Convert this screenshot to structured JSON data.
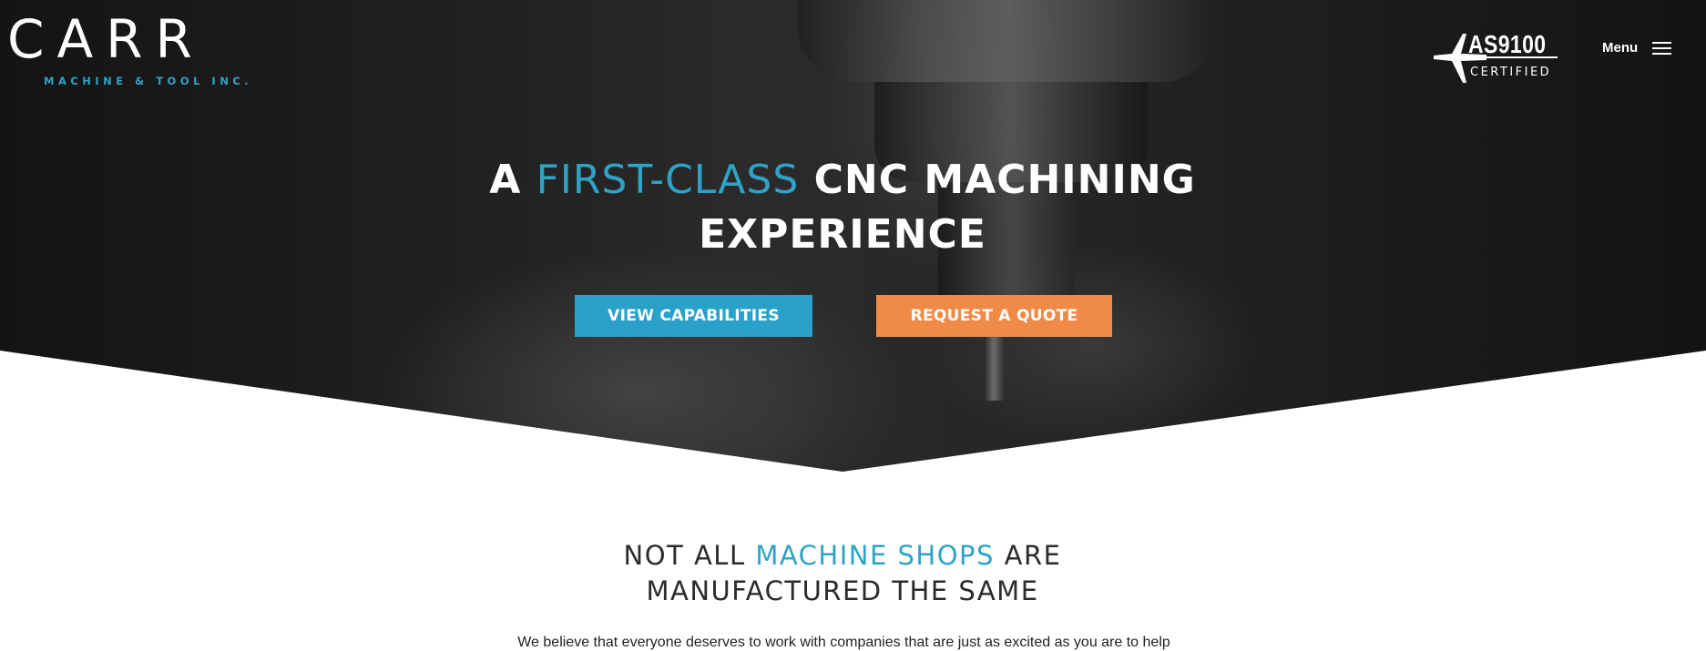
{
  "header": {
    "logo_word": "CARR",
    "logo_sub": "MACHINE & TOOL INC.",
    "cert_title": "AS9100",
    "cert_sub": "CERTIFIED",
    "menu_label": "Menu"
  },
  "hero": {
    "headline_part1": "A ",
    "headline_accent": "FIRST-CLASS",
    "headline_part2": " CNC MACHINING",
    "headline_line2": "EXPERIENCE",
    "button_capabilities": "VIEW CAPABILITIES",
    "button_quote": "REQUEST A QUOTE"
  },
  "section": {
    "title_part1": "NOT ALL ",
    "title_accent": "MACHINE SHOPS",
    "title_part2": " ARE",
    "title_line2": "MANUFACTURED THE SAME",
    "body": "We believe that everyone deserves to work with companies that are just as excited as you are to help"
  },
  "colors": {
    "accent_blue": "#2fa3c7",
    "button_blue": "#2aa1c9",
    "button_orange": "#f08b47",
    "text_dark": "#2b2b2b"
  },
  "icons": {
    "cert_logo": "airplane-icon",
    "menu": "hamburger-icon"
  }
}
